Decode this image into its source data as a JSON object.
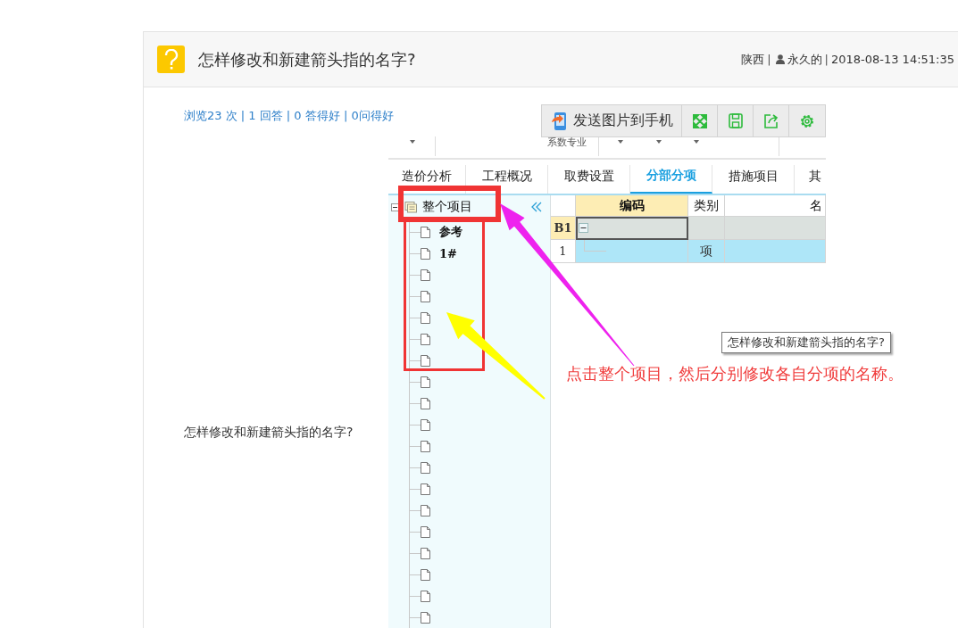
{
  "question": {
    "title": "怎样修改和新建箭头指的名字?",
    "separator": "|",
    "region": "陕西",
    "author": "永久的",
    "time": "2018-08-13 14:51:35"
  },
  "stats": "浏览23 次 | 1 回答 | 0 答得好 | 0问得好",
  "image_toolbar": {
    "send_label": "发送图片到手机"
  },
  "caption": "怎样修改和新建箭头指的名字?",
  "screenshot": {
    "filter_label": "系数专业",
    "tabs": [
      {
        "label": "造价分析",
        "selected": false
      },
      {
        "label": "工程概况",
        "selected": false
      },
      {
        "label": "取费设置",
        "selected": false
      },
      {
        "label": "分部分项",
        "selected": true
      },
      {
        "label": "措施项目",
        "selected": false
      },
      {
        "label": "其",
        "selected": false
      }
    ],
    "tree": {
      "label": "整个项目",
      "expanded": true,
      "children": [
        {
          "kind": "file",
          "label": "参考"
        },
        {
          "kind": "file",
          "label": "1#"
        },
        {
          "kind": "file"
        },
        {
          "kind": "file"
        },
        {
          "kind": "file"
        },
        {
          "kind": "file"
        },
        {
          "kind": "file"
        },
        {
          "kind": "file"
        },
        {
          "kind": "file"
        },
        {
          "kind": "file"
        },
        {
          "kind": "file"
        },
        {
          "kind": "file"
        },
        {
          "kind": "file"
        },
        {
          "kind": "file"
        },
        {
          "kind": "file"
        },
        {
          "kind": "file"
        },
        {
          "kind": "file"
        },
        {
          "kind": "file"
        },
        {
          "kind": "file"
        }
      ]
    },
    "grid": {
      "columns": [
        "编码",
        "类别",
        "名"
      ],
      "rows": [
        {
          "kind": "group",
          "row_header": "B1",
          "expanded": true,
          "selected": true
        },
        {
          "kind": "item",
          "row_header": "1",
          "type": "项",
          "selected": false
        }
      ]
    },
    "tooltip": "怎样修改和新建箭头指的名字?",
    "annotation": "点击整个项目，然后分别修改各自分项的名称。"
  }
}
